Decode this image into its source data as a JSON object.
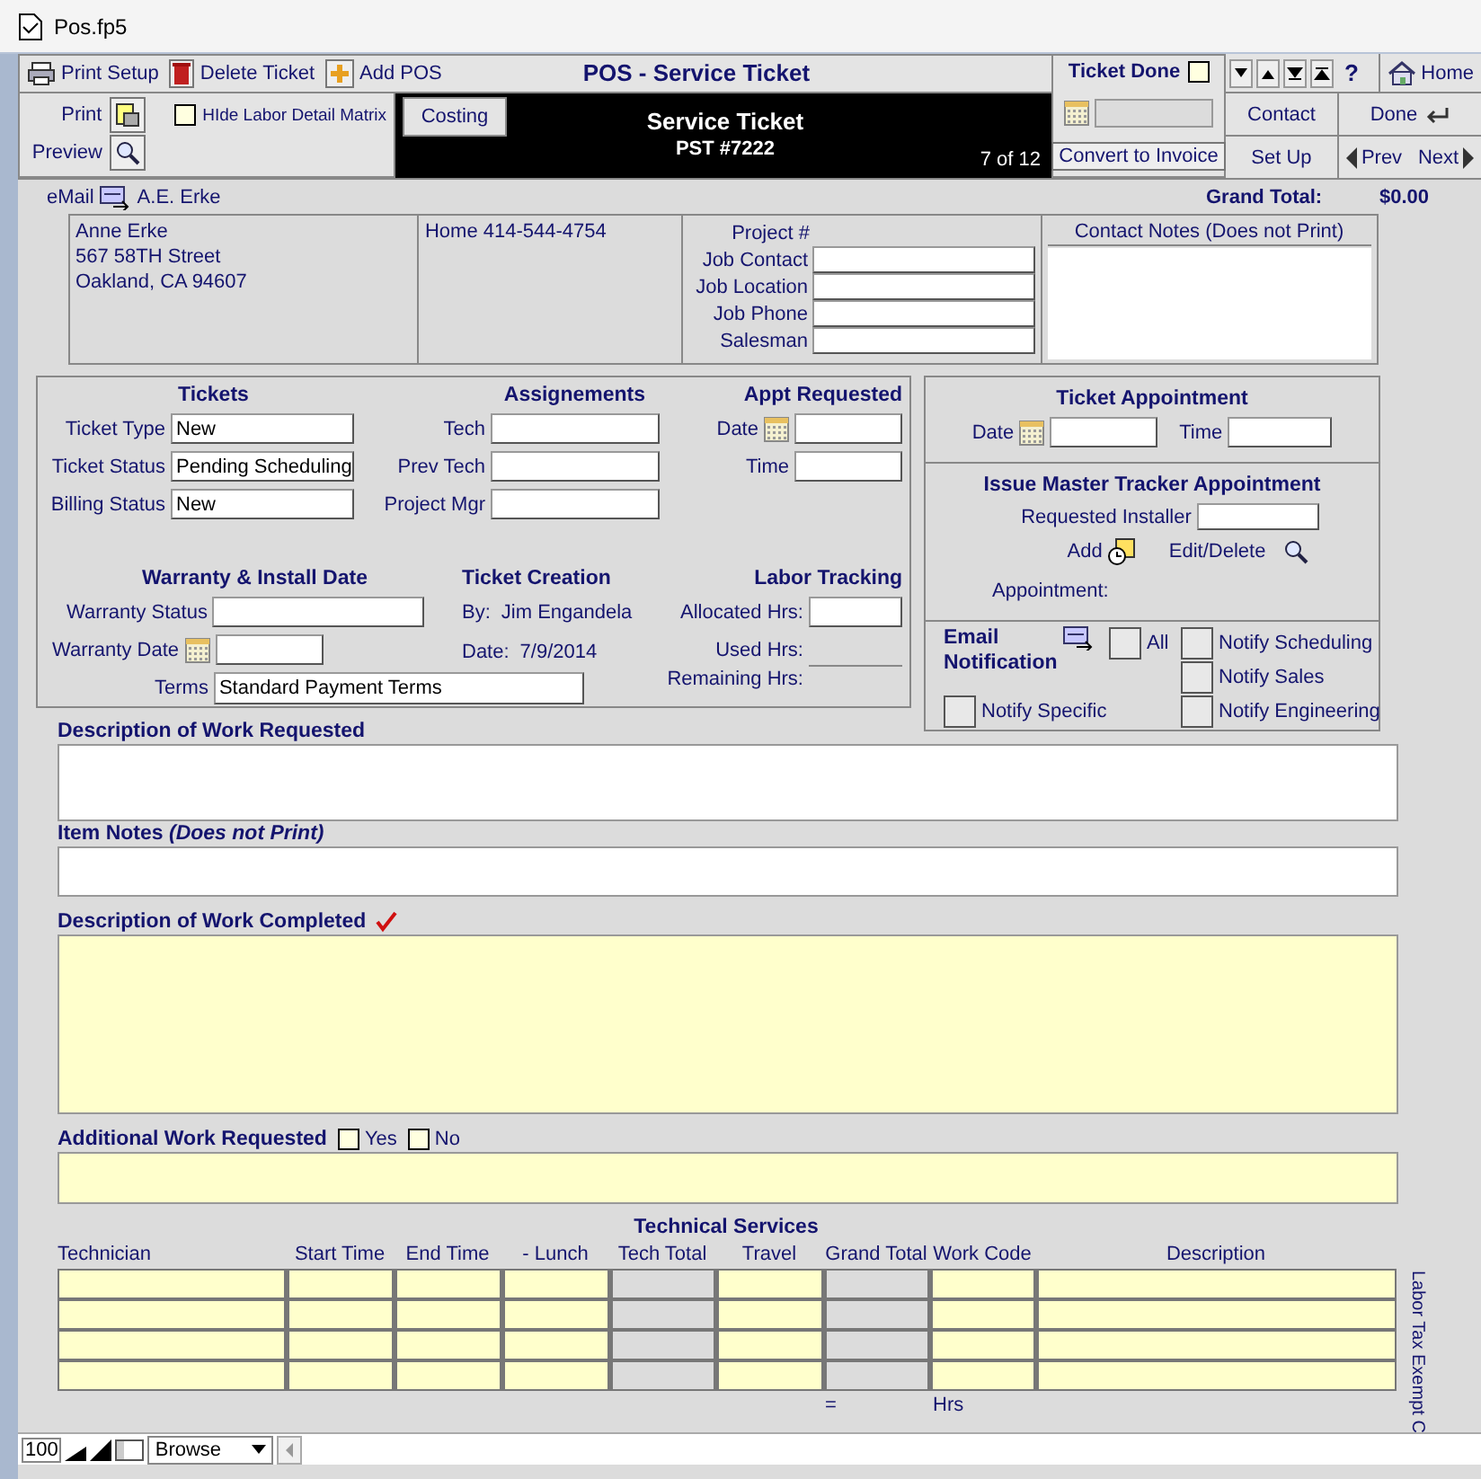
{
  "window": {
    "title": "Pos.fp5"
  },
  "toolbar": {
    "buttons": [
      {
        "label": "Print Setup",
        "kind": "printer"
      },
      {
        "label": "Delete Ticket",
        "kind": "trash"
      },
      {
        "label": "Add POS",
        "kind": "add"
      }
    ],
    "title": "POS - Service Ticket"
  },
  "print_panel": {
    "print": "Print",
    "preview": "Preview",
    "hide_labor": {
      "label": "HIde Labor Detail Matrix",
      "checked": false
    }
  },
  "header": {
    "tab": "Costing",
    "title": "Service Ticket",
    "number": "PST #7222",
    "record": "7 of 12"
  },
  "ticket_done": {
    "label": "Ticket Done",
    "checked": false,
    "convert": "Convert to Invoice"
  },
  "nav": {
    "help": "?",
    "home": "Home",
    "contact": "Contact",
    "done": "Done",
    "setup": "Set Up",
    "prev": "Prev",
    "next": "Next"
  },
  "summary": {
    "email": "eMail",
    "contact": "A.E. Erke",
    "total_label": "Grand Total:",
    "total": "$0.00"
  },
  "customer": {
    "address": [
      "Anne Erke",
      "567 58TH Street",
      "Oakland, CA 94607"
    ],
    "phone": "Home 414-544-4754",
    "project_label": "Project #",
    "job_fields": [
      {
        "label": "Job Contact"
      },
      {
        "label": "Job Location"
      },
      {
        "label": "Job Phone"
      },
      {
        "label": "Salesman"
      }
    ],
    "notes_title": "Contact Notes (Does not Print)"
  },
  "tickets": {
    "title": "Tickets",
    "fields": [
      {
        "label": "Ticket Type",
        "value": "New"
      },
      {
        "label": "Ticket Status",
        "value": "Pending Scheduling"
      },
      {
        "label": "Billing Status",
        "value": "New"
      }
    ]
  },
  "assignments": {
    "title": "Assignements",
    "fields": [
      {
        "label": "Tech"
      },
      {
        "label": "Prev Tech"
      },
      {
        "label": "Project Mgr"
      }
    ]
  },
  "appt_requested": {
    "title": "Appt Requested",
    "date": "Date",
    "time": "Time"
  },
  "warranty": {
    "title": "Warranty & Install Date",
    "status": "Warranty Status",
    "date": "Warranty Date",
    "terms_label": "Terms",
    "terms": "Standard Payment Terms"
  },
  "creation": {
    "title": "Ticket Creation",
    "by_label": "By:",
    "by": "Jim Engandela",
    "date_label": "Date:",
    "date": "7/9/2014"
  },
  "labor": {
    "title": "Labor Tracking",
    "allocated": "Allocated Hrs:",
    "used": "Used Hrs:",
    "remaining": "Remaining Hrs:"
  },
  "ticket_appointment": {
    "title": "Ticket Appointment",
    "date": "Date",
    "time": "Time"
  },
  "tracker": {
    "title": "Issue Master Tracker Appointment",
    "installer": "Requested Installer",
    "add": "Add",
    "edit": "Edit/Delete",
    "appointment": "Appointment:"
  },
  "notification": {
    "title": "Email Notification",
    "options": [
      {
        "label": "All",
        "checked": false
      },
      {
        "label": "Notify Scheduling",
        "checked": false
      },
      {
        "label": "Notify Sales",
        "checked": false
      },
      {
        "label": "Notify Specific",
        "checked": false
      },
      {
        "label": "Notify Engineering",
        "checked": false
      }
    ]
  },
  "work_requested": {
    "label": "Description of Work Requested"
  },
  "item_notes": {
    "label": "Item Notes *(Does not Print)*"
  },
  "work_completed": {
    "label": "Description of Work Completed"
  },
  "additional": {
    "label": "Additional Work Requested",
    "options": [
      {
        "label": "Yes",
        "checked": false
      },
      {
        "label": "No",
        "checked": false
      }
    ]
  },
  "technical_services": {
    "title": "Technical Services",
    "columns": [
      {
        "label": "Technician",
        "kind": "entry"
      },
      {
        "label": "Start Time",
        "kind": "entry"
      },
      {
        "label": "End Time",
        "kind": "entry"
      },
      {
        "label": "- Lunch",
        "kind": "entry"
      },
      {
        "label": "Tech Total",
        "kind": "computed"
      },
      {
        "label": "Travel",
        "kind": "entry"
      },
      {
        "label": "Grand Total",
        "kind": "computed"
      },
      {
        "label": "Work Code",
        "kind": "entry"
      },
      {
        "label": "Description",
        "kind": "entry"
      }
    ],
    "rows": [
      {
        "kind": "blank"
      },
      {
        "kind": "blank"
      },
      {
        "kind": "blank"
      },
      {
        "kind": "blank"
      }
    ],
    "equals": "=",
    "hours": "Hrs",
    "side_note": "Labor Tax Exempt C"
  },
  "status_bar": {
    "zoom": "100",
    "mode": "Browse"
  }
}
